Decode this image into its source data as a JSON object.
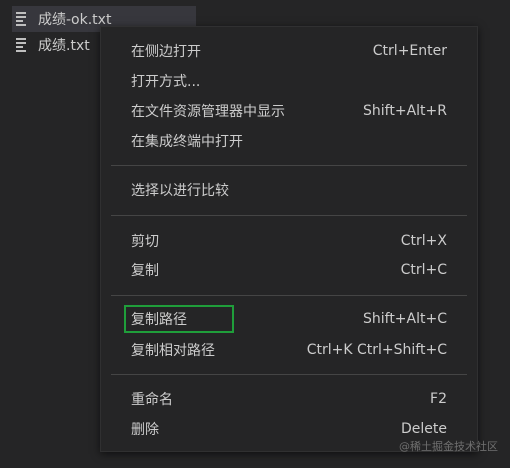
{
  "explorer": {
    "files": [
      {
        "name": "成绩-ok.txt",
        "selected": true
      },
      {
        "name": "成绩.txt",
        "selected": false
      }
    ]
  },
  "context_menu": {
    "groups": [
      [
        {
          "label": "在侧边打开",
          "shortcut": "Ctrl+Enter"
        },
        {
          "label": "打开方式...",
          "shortcut": ""
        },
        {
          "label": "在文件资源管理器中显示",
          "shortcut": "Shift+Alt+R"
        },
        {
          "label": "在集成终端中打开",
          "shortcut": ""
        }
      ],
      [
        {
          "label": "选择以进行比较",
          "shortcut": ""
        }
      ],
      [
        {
          "label": "剪切",
          "shortcut": "Ctrl+X"
        },
        {
          "label": "复制",
          "shortcut": "Ctrl+C"
        }
      ],
      [
        {
          "label": "复制路径",
          "shortcut": "Shift+Alt+C"
        },
        {
          "label": "复制相对路径",
          "shortcut": "Ctrl+K Ctrl+Shift+C"
        }
      ],
      [
        {
          "label": "重命名",
          "shortcut": "F2"
        },
        {
          "label": "删除",
          "shortcut": "Delete"
        }
      ]
    ]
  },
  "watermark": "@稀土掘金技术社区",
  "colors": {
    "background": "#252526",
    "text": "#cccccc",
    "separator": "#454545",
    "focus_outline": "#1f9e3a",
    "selected_row": "#37373d"
  }
}
